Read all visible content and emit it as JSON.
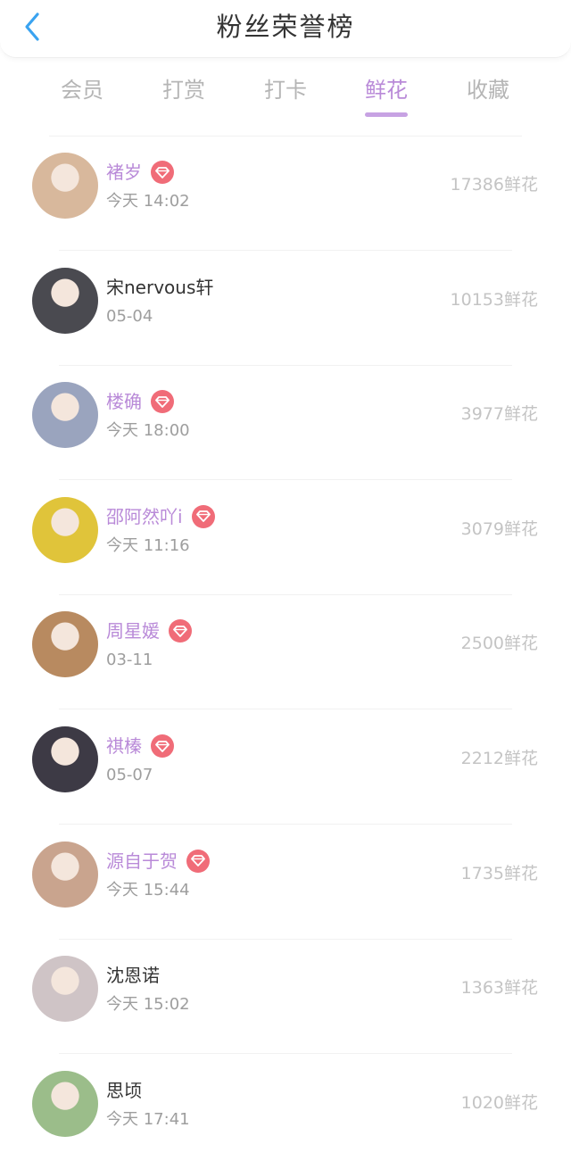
{
  "header": {
    "title": "粉丝荣誉榜"
  },
  "tabs": [
    {
      "label": "会员",
      "active": false
    },
    {
      "label": "打赏",
      "active": false
    },
    {
      "label": "打卡",
      "active": false
    },
    {
      "label": "鲜花",
      "active": true
    },
    {
      "label": "收藏",
      "active": false
    }
  ],
  "colors": {
    "accent": "#b98ad8",
    "badge": "#f06c78",
    "back_arrow": "#3aa3f0"
  },
  "rows": [
    {
      "name": "褚岁",
      "vip": true,
      "time": "今天 14:02",
      "score": "17386鲜花",
      "avatar_color": "#d8b89c"
    },
    {
      "name": "宋nervous轩",
      "vip": false,
      "time": "05-04",
      "score": "10153鲜花",
      "avatar_color": "#4a4a50"
    },
    {
      "name": "楼确",
      "vip": true,
      "time": "今天 18:00",
      "score": "3977鲜花",
      "avatar_color": "#9aa4be"
    },
    {
      "name": "邵阿然吖i",
      "vip": true,
      "time": "今天 11:16",
      "score": "3079鲜花",
      "avatar_color": "#e0c43a"
    },
    {
      "name": "周星媛",
      "vip": true,
      "time": "03-11",
      "score": "2500鲜花",
      "avatar_color": "#b88a60"
    },
    {
      "name": "祺榛",
      "vip": true,
      "time": "05-07",
      "score": "2212鲜花",
      "avatar_color": "#3d3a45"
    },
    {
      "name": "源自于贺",
      "vip": true,
      "time": "今天 15:44",
      "score": "1735鲜花",
      "avatar_color": "#c9a48e"
    },
    {
      "name": "沈恩诺",
      "vip": false,
      "time": "今天 15:02",
      "score": "1363鲜花",
      "avatar_color": "#cfc4c6"
    },
    {
      "name": "思顷",
      "vip": false,
      "time": "今天 17:41",
      "score": "1020鲜花",
      "avatar_color": "#9bbd8a"
    }
  ]
}
